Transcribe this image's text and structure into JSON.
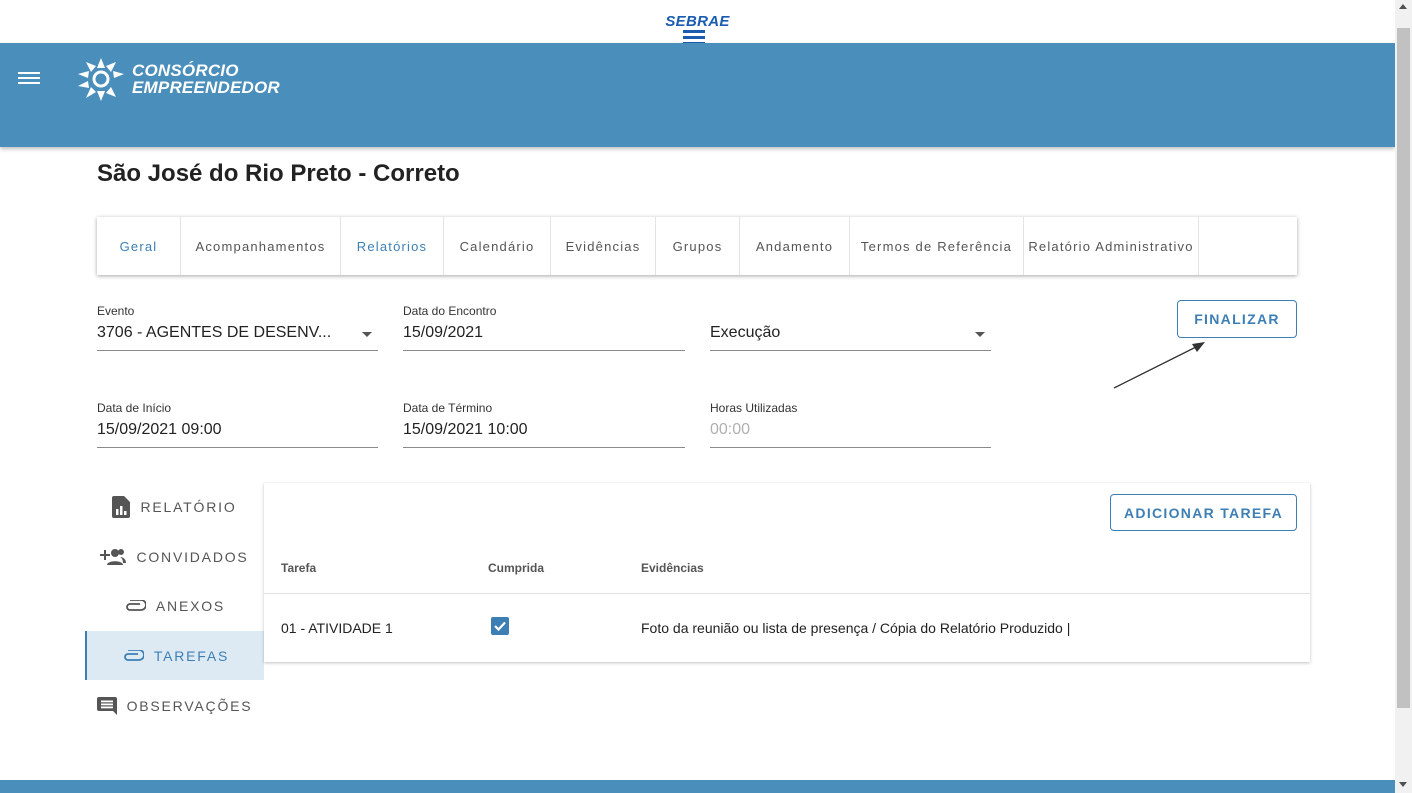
{
  "sebrae_logo": "SEBRAE",
  "brand": {
    "line1": "CONSÓRCIO",
    "line2": "EMPREENDEDOR"
  },
  "page_title": "São José do Rio Preto - Correto",
  "tabs": [
    {
      "label": "Geral",
      "active": true
    },
    {
      "label": "Acompanhamentos",
      "active": false
    },
    {
      "label": "Relatórios",
      "active": true
    },
    {
      "label": "Calendário",
      "active": false
    },
    {
      "label": "Evidências",
      "active": false
    },
    {
      "label": "Grupos",
      "active": false
    },
    {
      "label": "Andamento",
      "active": false
    },
    {
      "label": "Termos de Referência",
      "active": false
    },
    {
      "label": "Relatório Administrativo",
      "active": false
    }
  ],
  "form": {
    "evento": {
      "label": "Evento",
      "value": "3706 - AGENTES DE DESENV..."
    },
    "data_encontro": {
      "label": "Data do Encontro",
      "value": "15/09/2021"
    },
    "status": {
      "value": "Execução"
    },
    "data_inicio": {
      "label": "Data de Início",
      "value": "15/09/2021 09:00"
    },
    "data_termino": {
      "label": "Data de Término",
      "value": "15/09/2021 10:00"
    },
    "horas_utilizadas": {
      "label": "Horas Utilizadas",
      "placeholder": "00:00"
    }
  },
  "finalizar_button": "FINALIZAR",
  "side_menu": [
    {
      "label": "RELATÓRIO",
      "icon": "report-icon",
      "active": false
    },
    {
      "label": "CONVIDADOS",
      "icon": "add-people-icon",
      "active": false
    },
    {
      "label": "ANEXOS",
      "icon": "attachment-icon",
      "active": false
    },
    {
      "label": "TAREFAS",
      "icon": "attachment-icon",
      "active": true
    },
    {
      "label": "OBSERVAÇÕES",
      "icon": "notes-icon",
      "active": false
    }
  ],
  "tasks": {
    "add_button": "ADICIONAR TAREFA",
    "columns": [
      "Tarefa",
      "Cumprida",
      "Evidências"
    ],
    "rows": [
      {
        "tarefa": "01 - ATIVIDADE 1",
        "cumprida": true,
        "evidencias": "Foto da reunião ou lista de presença / Cópia do Relatório Produzido |"
      }
    ]
  },
  "colors": {
    "header": "#4a8ebb",
    "accent": "#3d7fb5",
    "sebrae": "#1a5db0"
  }
}
